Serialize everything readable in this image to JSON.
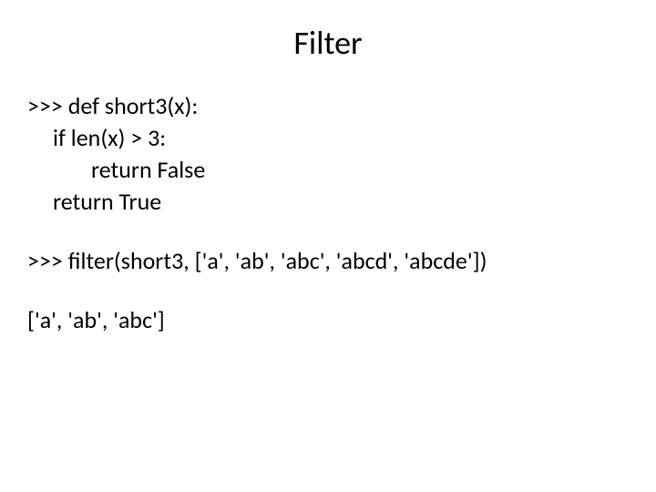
{
  "title": "Filter",
  "code": {
    "line1": ">>> def short3(x):",
    "line2": "if len(x) > 3:",
    "line3": "return False",
    "line4": "return True"
  },
  "call": ">>> filter(short3, ['a', 'ab', 'abc', 'abcd', 'abcde'])",
  "result": "['a', 'ab', 'abc']"
}
